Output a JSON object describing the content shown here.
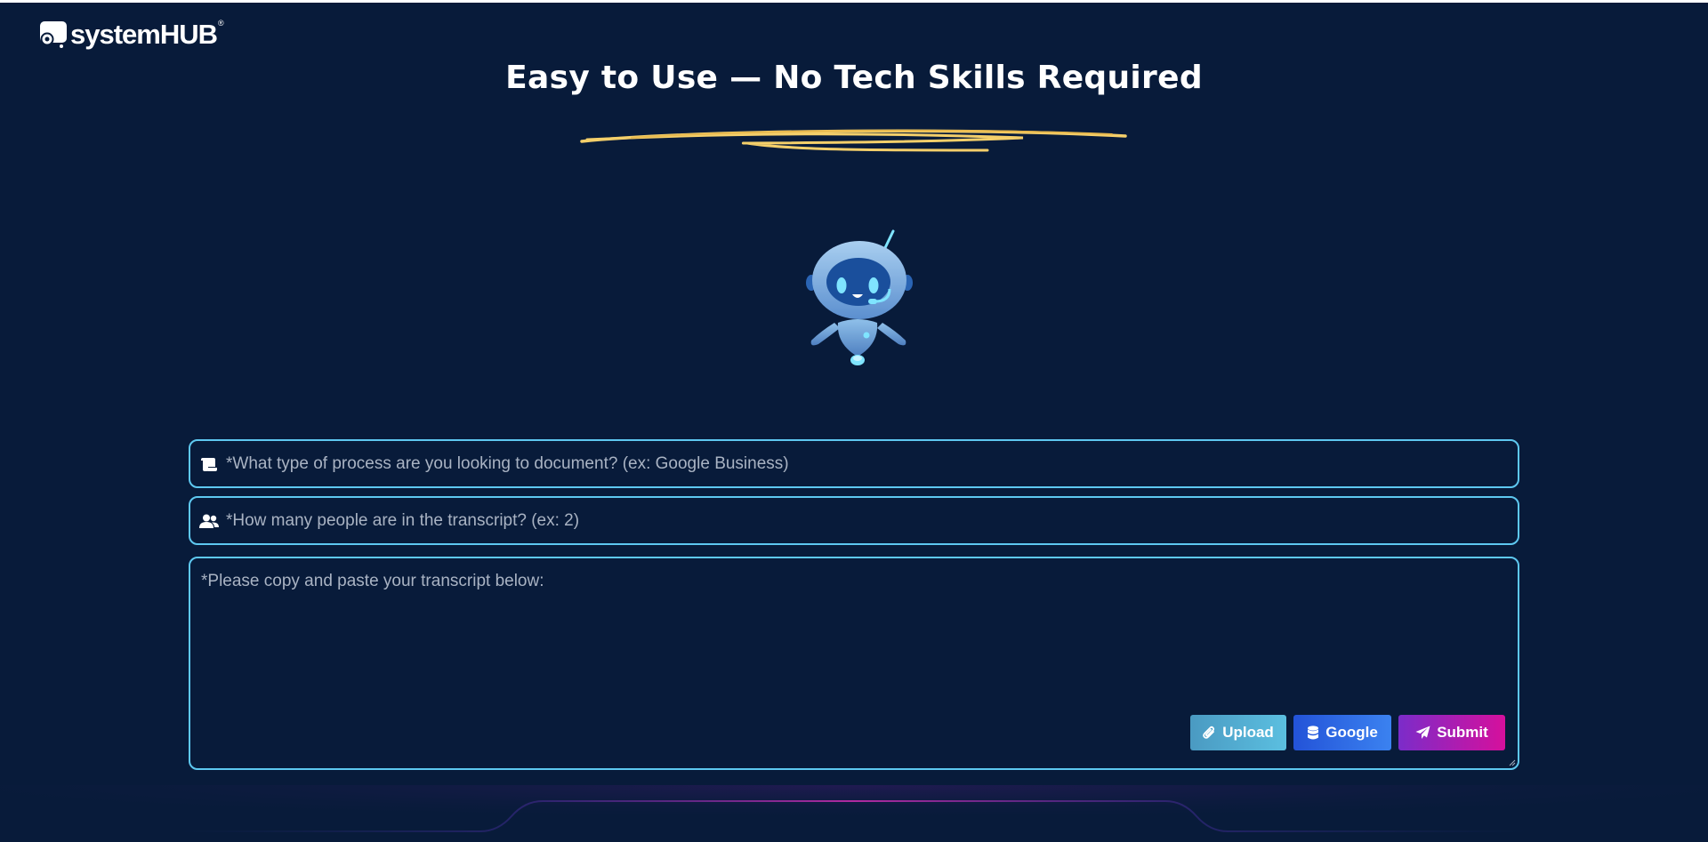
{
  "brand": {
    "name": "systemHUB",
    "reg_mark": "®"
  },
  "hero": {
    "headline": "Easy to Use — No Tech Skills Required"
  },
  "form": {
    "process_field": {
      "placeholder": "*What type of process are you looking to document? (ex: Google Business)",
      "value": "",
      "icon": "scroll-icon"
    },
    "people_field": {
      "placeholder": "*How many people are in the transcript? (ex: 2)",
      "value": "",
      "icon": "users-icon"
    },
    "transcript_field": {
      "placeholder": "*Please copy and paste your transcript below:",
      "value": ""
    },
    "buttons": {
      "upload_label": "Upload",
      "google_label": "Google",
      "submit_label": "Submit"
    }
  },
  "colors": {
    "background": "#081b3a",
    "field_border": "#5ec8f0",
    "underline_scribble": "#f4cf6a",
    "upload_button": "#4a9ac2",
    "google_button": "#2353d8",
    "submit_button_start": "#7b2cc9",
    "submit_button_end": "#d6109c"
  }
}
